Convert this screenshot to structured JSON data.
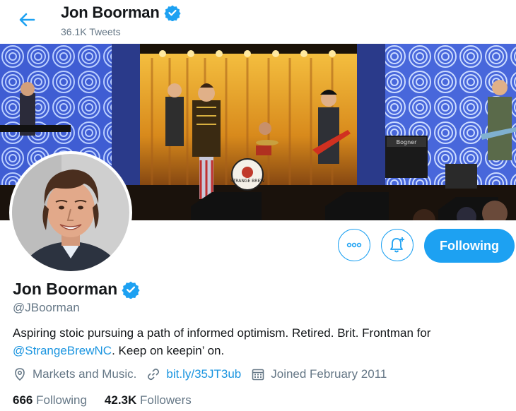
{
  "header": {
    "name": "Jon Boorman",
    "tweets": "36.1K Tweets"
  },
  "banner": {
    "drum_text": "STRANGE BREW",
    "amp_brand": "Bogner"
  },
  "profile": {
    "name": "Jon Boorman",
    "handle": "@JBoorman",
    "bio_text": "Aspiring stoic pursuing a path of informed optimism. Retired. Brit. Frontman for",
    "bio_mention": "@StrangeBrewNC",
    "bio_suffix": ". Keep on keepin’ on.",
    "location": "Markets and Music.",
    "link": "bit.ly/35JT3ub",
    "joined": "Joined February 2011",
    "following_count": "666",
    "following_label": "Following",
    "followers_count": "42.3K",
    "followers_label": "Followers"
  },
  "actions": {
    "follow_button": "Following"
  },
  "colors": {
    "accent": "#1da1f2",
    "link": "#1b95e0",
    "muted": "#657786"
  },
  "icons": [
    "back-arrow-icon",
    "verified-badge-icon",
    "more-icon",
    "notification-bell-icon",
    "location-icon",
    "link-icon",
    "calendar-icon"
  ]
}
